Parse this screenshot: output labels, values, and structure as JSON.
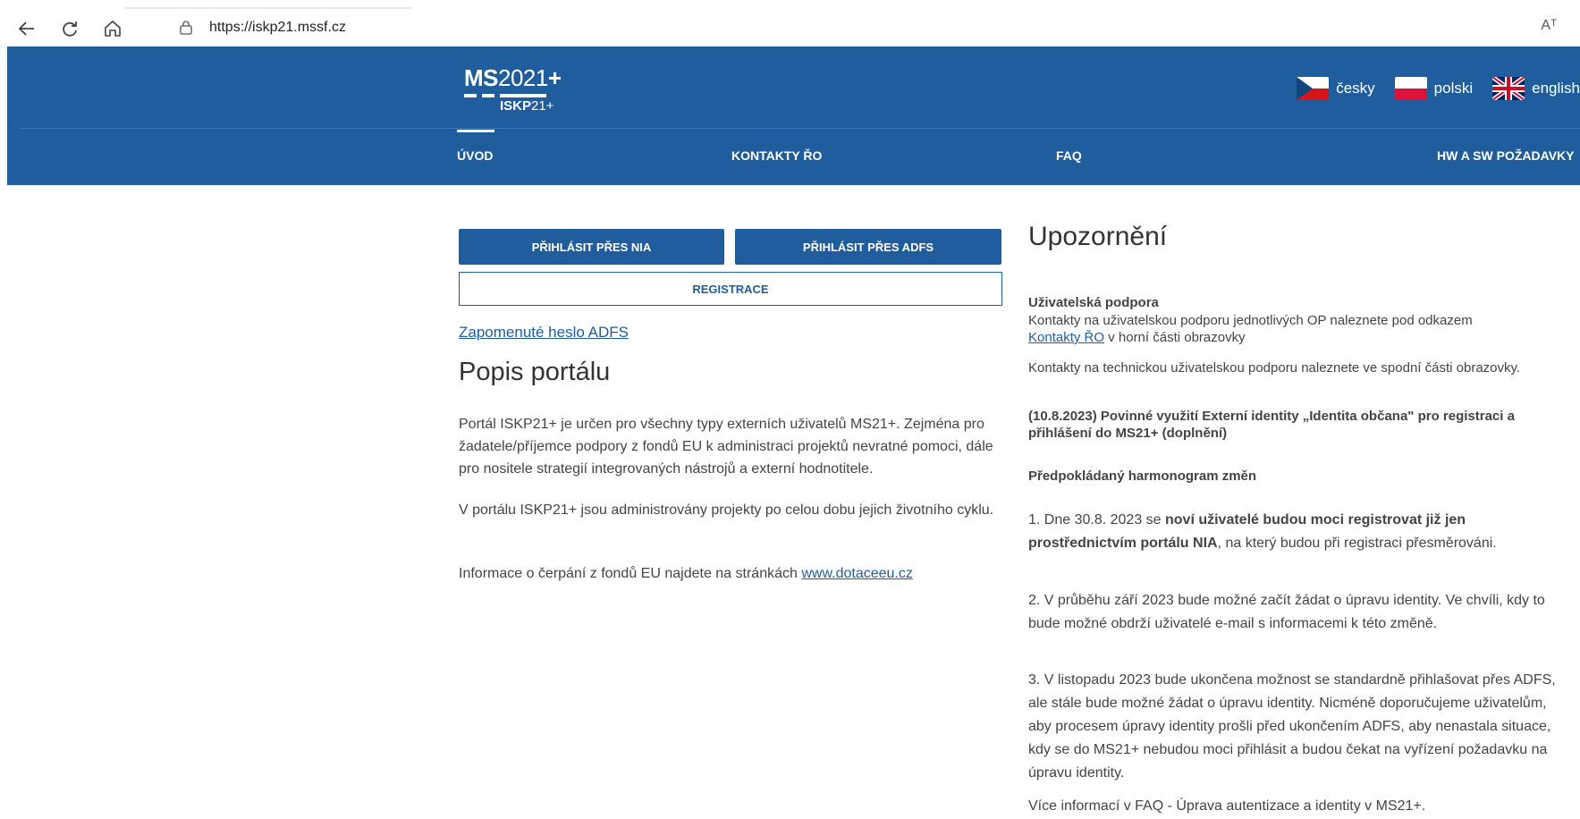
{
  "browser": {
    "url": "https://iskp21.mssf.cz",
    "reader_label": "Aᵀ"
  },
  "colors": {
    "brand": "#1f5d9c"
  },
  "logo": {
    "ms": "MS",
    "year": "2021",
    "plus": "+",
    "iskp": "ISKP",
    "iskp_num": "21+"
  },
  "languages": [
    {
      "label": "česky"
    },
    {
      "label": "polski"
    },
    {
      "label": "english"
    }
  ],
  "menu": {
    "items": [
      {
        "label": "ÚVOD"
      },
      {
        "label": "KONTAKTY ŘO"
      },
      {
        "label": "FAQ"
      },
      {
        "label": "HW A SW POŽADAVKY"
      }
    ]
  },
  "login": {
    "nia_label": "PŘIHLÁSIT PŘES NIA",
    "adfs_label": "PŘIHLÁSIT PŘES ADFS",
    "register_label": "REGISTRACE",
    "forgot_label": "Zapomenuté heslo ADFS"
  },
  "portal": {
    "title": "Popis portálu",
    "p1": "Portál ISKP21+ je určen pro všechny typy externích uživatelů MS21+. Zejména pro žadatele/příjemce podpory z fondů EU k administraci projektů nevratné pomoci, dále pro nositele strategií integrovaných nástrojů a externí hodnotitele.",
    "p2": "V portálu ISKP21+ jsou administrovány projekty po celou dobu jejich životního cyklu.",
    "p3_prefix": "Informace o čerpání z fondů EU najdete na stránkách ",
    "p3_link": "www.dotaceeu.cz"
  },
  "notice": {
    "title": "Upozornění",
    "support_heading": "Uživatelská podpora",
    "support_text": "Kontakty na uživatelskou podporu jednotlivých OP naleznete pod odkazem",
    "support_link": "Kontakty ŘO",
    "support_suffix": " v horní části obrazovky",
    "tech_text": "Kontakty na technickou uživatelskou podporu naleznete ve spodní části obrazovky.",
    "announcement": "(10.8.2023) Povinné využití Externí identity „Identita občana\" pro registraci a přihlášení do MS21+ (doplnění)",
    "schedule_heading": "Předpokládaný harmonogram změn",
    "step1_a": "1. Dne 30.8. 2023 se ",
    "step1_b": "noví uživatelé budou moci registrovat již jen prostřednictvím portálu NIA",
    "step1_c": ", na který budou při registraci přesměrováni.",
    "step2": "2. V průběhu září 2023 bude možné začít žádat o úpravu identity. Ve chvíli, kdy to bude možné obdrží uživatelé e-mail s informacemi k této změně.",
    "step3": "3. V listopadu 2023 bude ukončena možnost se standardně přihlašovat přes ADFS, ale stále bude možné žádat o úpravu identity. Nicméně doporučujeme uživatelům, aby procesem úpravy identity prošli před ukončením ADFS, aby nenastala situace, kdy se do MS21+ nebudou moci přihlásit a budou čekat na vyřízení požadavku na úpravu identity.",
    "more": "Více informací v FAQ - Úprava autentizace a identity v MS21+."
  }
}
